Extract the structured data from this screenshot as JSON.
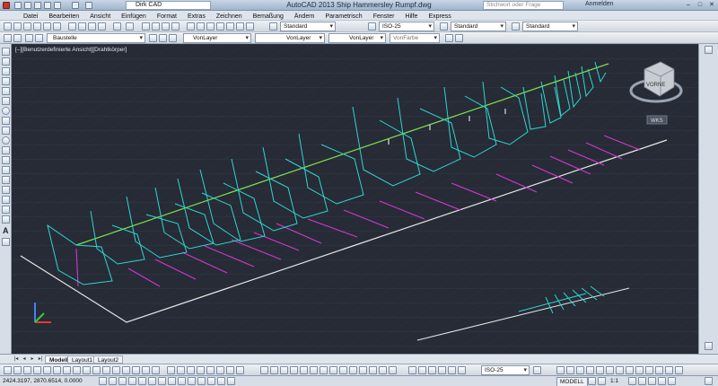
{
  "app": {
    "title": "AutoCAD 2013   Ship Hammersley Rumpf.dwg",
    "workspace": "Dirk CAD",
    "search_placeholder": "Stichwort oder Frage eingeben",
    "login_label": "Anmelden"
  },
  "menu": [
    "Datei",
    "Bearbeiten",
    "Ansicht",
    "Einfügen",
    "Format",
    "Extras",
    "Zeichnen",
    "Bemaßung",
    "Ändern",
    "Parametrisch",
    "Fenster",
    "Hilfe",
    "Express"
  ],
  "toolbar1": {
    "text_style": "Standard",
    "dim_style": "ISO-25",
    "table_style": "Standard",
    "multileader_style": "Standard"
  },
  "toolbar2": {
    "layer": "Baustelle",
    "color": "VonLayer",
    "linetype": "VonLayer",
    "lineweight": "VonLayer",
    "plotstyle": "VonFarbe"
  },
  "viewport": {
    "label": "[–][Benutzerdefinierte Ansicht][Drahtkörper]",
    "viewcube": "VORNE",
    "wcs": "WKS"
  },
  "tabs": [
    "Modell",
    "Layout1",
    "Layout2"
  ],
  "bottom_toolbar": {
    "dim_style": "ISO-25"
  },
  "status": {
    "coords": "2424.3197, 2870.6514, 0.0000",
    "space": "MODELL",
    "scale": "1:1"
  },
  "colors": {
    "viewport_bg": "#262b36",
    "hull": "#2fd6cf",
    "centerline": "#7fe04a",
    "magenta": "#d437d0",
    "outline": "#e6e6e6"
  }
}
